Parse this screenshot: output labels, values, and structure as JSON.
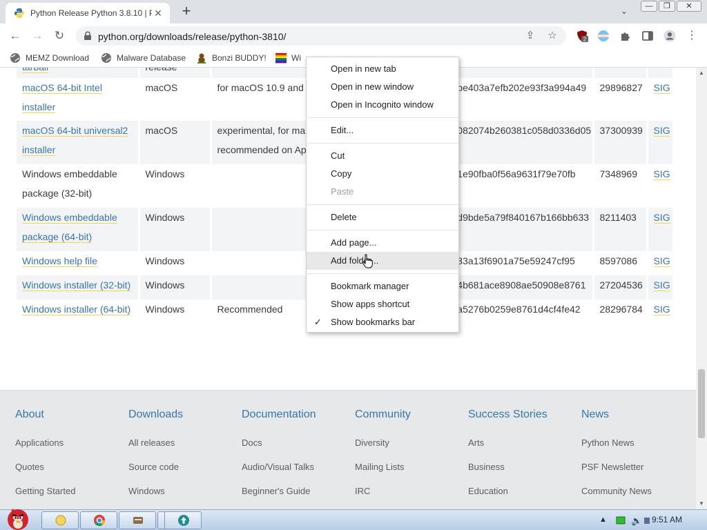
{
  "browser": {
    "tab": {
      "title": "Python Release Python 3.8.10 | P",
      "close": "✕"
    },
    "new_tab": "+",
    "tab_search": "⌄",
    "window_controls": {
      "minimize": "—",
      "restore": "❐",
      "close": "✕"
    },
    "nav": {
      "back": "←",
      "forward": "→",
      "reload": "↻"
    },
    "url": "python.org/downloads/release/python-3810/",
    "share": "⇪",
    "star": "☆",
    "extension_badge": "2",
    "menu": "⋮"
  },
  "bookmarks": [
    {
      "label": "MEMZ Download",
      "icon": "globe-icon"
    },
    {
      "label": "Malware Database",
      "icon": "globe-icon"
    },
    {
      "label": "Bonzi BUDDY!",
      "icon": "bonzi-icon"
    },
    {
      "label": "Wi",
      "icon": "windows-flag-icon"
    }
  ],
  "table": {
    "rows": [
      {
        "name": [
          "tarball"
        ],
        "link": true,
        "os": [
          "release"
        ],
        "desc": [
          ""
        ],
        "md5": "",
        "size": "",
        "sig": ""
      },
      {
        "name": [
          "macOS 64-bit Intel",
          "installer"
        ],
        "link": true,
        "os": [
          "macOS"
        ],
        "desc": [
          "for macOS 10.9 and l"
        ],
        "md5": "1be403a7efb202e93f3a994a49",
        "size": "29896827",
        "sig": "SIG"
      },
      {
        "name": [
          "macOS 64-bit universal2",
          "installer"
        ],
        "link": true,
        "os": [
          "macOS"
        ],
        "desc": [
          "experimental, for ma",
          "recommended on Ap"
        ],
        "md5": "e082074b260381c058d0336d05",
        "size": "37300939",
        "sig": "SIG"
      },
      {
        "name": [
          "Windows embeddable",
          "package (32-bit)"
        ],
        "link": false,
        "os": [
          "Windows"
        ],
        "desc": [
          ""
        ],
        "md5": "21e90fba0f56a9631f79e70fb",
        "size": "7348969",
        "sig": "SIG"
      },
      {
        "name": [
          "Windows embeddable",
          "package (64-bit)"
        ],
        "link": true,
        "os": [
          "Windows"
        ],
        "desc": [
          ""
        ],
        "md5": "7d9bde5a79f840167b166bb633",
        "size": "8211403",
        "sig": "SIG"
      },
      {
        "name": [
          "Windows help file"
        ],
        "link": true,
        "os": [
          "Windows"
        ],
        "desc": [
          ""
        ],
        "md5": "933a13f6901a75e59247cf95",
        "size": "8597086",
        "sig": "SIG"
      },
      {
        "name": [
          "Windows installer (32-bit)"
        ],
        "link": true,
        "os": [
          "Windows"
        ],
        "desc": [
          ""
        ],
        "md5": "84b681ace8908ae50908e8761",
        "size": "27204536",
        "sig": "SIG"
      },
      {
        "name": [
          "Windows installer (64-bit)"
        ],
        "link": true,
        "os": [
          "Windows"
        ],
        "desc": [
          "Recommended"
        ],
        "md5": "2a5276b0259e8761d4cf4fe42",
        "size": "28296784",
        "sig": "SIG"
      }
    ]
  },
  "footer": {
    "columns": [
      {
        "heading": "About",
        "links": [
          "Applications",
          "Quotes",
          "Getting Started"
        ]
      },
      {
        "heading": "Downloads",
        "links": [
          "All releases",
          "Source code",
          "Windows"
        ]
      },
      {
        "heading": "Documentation",
        "links": [
          "Docs",
          "Audio/Visual Talks",
          "Beginner's Guide"
        ]
      },
      {
        "heading": "Community",
        "links": [
          "Diversity",
          "Mailing Lists",
          "IRC"
        ]
      },
      {
        "heading": "Success Stories",
        "links": [
          "Arts",
          "Business",
          "Education"
        ]
      },
      {
        "heading": "News",
        "links": [
          "Python News",
          "PSF Newsletter",
          "Community News"
        ]
      }
    ]
  },
  "context_menu": {
    "items": [
      {
        "label": "Open in new tab"
      },
      {
        "label": "Open in new window"
      },
      {
        "label": "Open in Incognito window"
      },
      {
        "sep": true
      },
      {
        "label": "Edit..."
      },
      {
        "sep": true
      },
      {
        "label": "Cut"
      },
      {
        "label": "Copy"
      },
      {
        "label": "Paste",
        "disabled": true
      },
      {
        "sep": true
      },
      {
        "label": "Delete"
      },
      {
        "sep": true
      },
      {
        "label": "Add page..."
      },
      {
        "label": "Add folder...",
        "hover": true
      },
      {
        "sep": true
      },
      {
        "label": "Bookmark manager"
      },
      {
        "label": "Show apps shortcut"
      },
      {
        "label": "Show bookmarks bar",
        "checked": true
      }
    ],
    "check_mark": "✓"
  },
  "taskbar": {
    "clock": "9:51 AM"
  },
  "colors": {
    "python_blue": "#3776ab",
    "python_yellow": "#ffd343",
    "footer_bg": "#e6e8ea"
  }
}
